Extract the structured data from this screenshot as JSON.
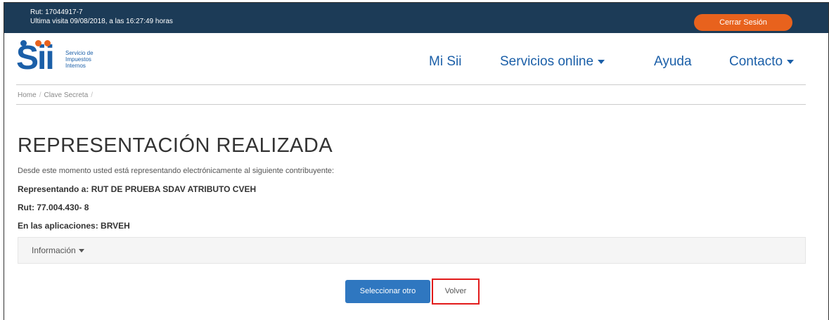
{
  "header": {
    "rut_line": "Rut: 17044917-7",
    "last_visit_line": "Ultima visita 09/08/2018, a las 16:27:49 horas",
    "logout_label": "Cerrar Sesión"
  },
  "logo": {
    "brand": "Sii",
    "subtitle_line1": "Servicio de",
    "subtitle_line2": "Impuestos",
    "subtitle_line3": "Internos",
    "dot_colors": [
      "#1b5fa8",
      "#e8621d",
      "#e8621d"
    ]
  },
  "nav": {
    "items": [
      {
        "label": "Mi Sii",
        "has_caret": false
      },
      {
        "label": "Servicios online",
        "has_caret": true
      },
      {
        "label": "Ayuda",
        "has_caret": false
      },
      {
        "label": "Contacto",
        "has_caret": true
      }
    ]
  },
  "breadcrumb": {
    "items": [
      "Home",
      "Clave Secreta"
    ],
    "separator": "/"
  },
  "main": {
    "title": "REPRESENTACIÓN REALIZADA",
    "description": "Desde este momento usted está representando electrónicamente al siguiente contribuyente:",
    "representando": "Representando a: RUT DE PRUEBA SDAV ATRIBUTO CVEH",
    "rut": "Rut: 77.004.430- 8",
    "aplicaciones": "En las aplicaciones: BRVEH",
    "info_label": "Información"
  },
  "actions": {
    "select_other_label": "Seleccionar otro",
    "back_label": "Volver"
  },
  "colors": {
    "topbar": "#1c3b57",
    "accent_orange": "#e8621d",
    "brand_blue": "#1b5fa8",
    "button_blue": "#2f77c0",
    "highlight_red": "#e21b1b"
  }
}
